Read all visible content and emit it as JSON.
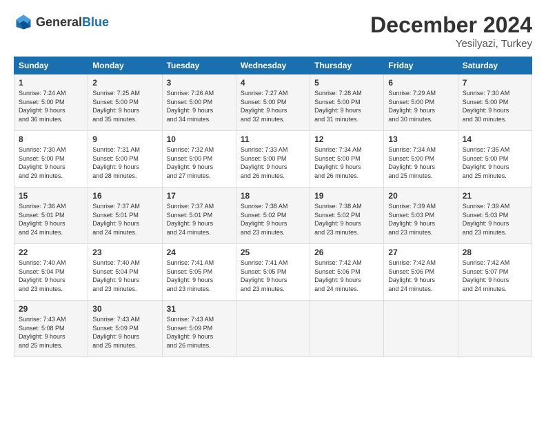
{
  "logo": {
    "text_general": "General",
    "text_blue": "Blue"
  },
  "title": "December 2024",
  "location": "Yesilyazi, Turkey",
  "weekdays": [
    "Sunday",
    "Monday",
    "Tuesday",
    "Wednesday",
    "Thursday",
    "Friday",
    "Saturday"
  ],
  "rows": [
    [
      {
        "day": "1",
        "lines": [
          "Sunrise: 7:24 AM",
          "Sunset: 5:00 PM",
          "Daylight: 9 hours",
          "and 36 minutes."
        ]
      },
      {
        "day": "2",
        "lines": [
          "Sunrise: 7:25 AM",
          "Sunset: 5:00 PM",
          "Daylight: 9 hours",
          "and 35 minutes."
        ]
      },
      {
        "day": "3",
        "lines": [
          "Sunrise: 7:26 AM",
          "Sunset: 5:00 PM",
          "Daylight: 9 hours",
          "and 34 minutes."
        ]
      },
      {
        "day": "4",
        "lines": [
          "Sunrise: 7:27 AM",
          "Sunset: 5:00 PM",
          "Daylight: 9 hours",
          "and 32 minutes."
        ]
      },
      {
        "day": "5",
        "lines": [
          "Sunrise: 7:28 AM",
          "Sunset: 5:00 PM",
          "Daylight: 9 hours",
          "and 31 minutes."
        ]
      },
      {
        "day": "6",
        "lines": [
          "Sunrise: 7:29 AM",
          "Sunset: 5:00 PM",
          "Daylight: 9 hours",
          "and 30 minutes."
        ]
      },
      {
        "day": "7",
        "lines": [
          "Sunrise: 7:30 AM",
          "Sunset: 5:00 PM",
          "Daylight: 9 hours",
          "and 30 minutes."
        ]
      }
    ],
    [
      {
        "day": "8",
        "lines": [
          "Sunrise: 7:30 AM",
          "Sunset: 5:00 PM",
          "Daylight: 9 hours",
          "and 29 minutes."
        ]
      },
      {
        "day": "9",
        "lines": [
          "Sunrise: 7:31 AM",
          "Sunset: 5:00 PM",
          "Daylight: 9 hours",
          "and 28 minutes."
        ]
      },
      {
        "day": "10",
        "lines": [
          "Sunrise: 7:32 AM",
          "Sunset: 5:00 PM",
          "Daylight: 9 hours",
          "and 27 minutes."
        ]
      },
      {
        "day": "11",
        "lines": [
          "Sunrise: 7:33 AM",
          "Sunset: 5:00 PM",
          "Daylight: 9 hours",
          "and 26 minutes."
        ]
      },
      {
        "day": "12",
        "lines": [
          "Sunrise: 7:34 AM",
          "Sunset: 5:00 PM",
          "Daylight: 9 hours",
          "and 26 minutes."
        ]
      },
      {
        "day": "13",
        "lines": [
          "Sunrise: 7:34 AM",
          "Sunset: 5:00 PM",
          "Daylight: 9 hours",
          "and 25 minutes."
        ]
      },
      {
        "day": "14",
        "lines": [
          "Sunrise: 7:35 AM",
          "Sunset: 5:00 PM",
          "Daylight: 9 hours",
          "and 25 minutes."
        ]
      }
    ],
    [
      {
        "day": "15",
        "lines": [
          "Sunrise: 7:36 AM",
          "Sunset: 5:01 PM",
          "Daylight: 9 hours",
          "and 24 minutes."
        ]
      },
      {
        "day": "16",
        "lines": [
          "Sunrise: 7:37 AM",
          "Sunset: 5:01 PM",
          "Daylight: 9 hours",
          "and 24 minutes."
        ]
      },
      {
        "day": "17",
        "lines": [
          "Sunrise: 7:37 AM",
          "Sunset: 5:01 PM",
          "Daylight: 9 hours",
          "and 24 minutes."
        ]
      },
      {
        "day": "18",
        "lines": [
          "Sunrise: 7:38 AM",
          "Sunset: 5:02 PM",
          "Daylight: 9 hours",
          "and 23 minutes."
        ]
      },
      {
        "day": "19",
        "lines": [
          "Sunrise: 7:38 AM",
          "Sunset: 5:02 PM",
          "Daylight: 9 hours",
          "and 23 minutes."
        ]
      },
      {
        "day": "20",
        "lines": [
          "Sunrise: 7:39 AM",
          "Sunset: 5:03 PM",
          "Daylight: 9 hours",
          "and 23 minutes."
        ]
      },
      {
        "day": "21",
        "lines": [
          "Sunrise: 7:39 AM",
          "Sunset: 5:03 PM",
          "Daylight: 9 hours",
          "and 23 minutes."
        ]
      }
    ],
    [
      {
        "day": "22",
        "lines": [
          "Sunrise: 7:40 AM",
          "Sunset: 5:04 PM",
          "Daylight: 9 hours",
          "and 23 minutes."
        ]
      },
      {
        "day": "23",
        "lines": [
          "Sunrise: 7:40 AM",
          "Sunset: 5:04 PM",
          "Daylight: 9 hours",
          "and 23 minutes."
        ]
      },
      {
        "day": "24",
        "lines": [
          "Sunrise: 7:41 AM",
          "Sunset: 5:05 PM",
          "Daylight: 9 hours",
          "and 23 minutes."
        ]
      },
      {
        "day": "25",
        "lines": [
          "Sunrise: 7:41 AM",
          "Sunset: 5:05 PM",
          "Daylight: 9 hours",
          "and 23 minutes."
        ]
      },
      {
        "day": "26",
        "lines": [
          "Sunrise: 7:42 AM",
          "Sunset: 5:06 PM",
          "Daylight: 9 hours",
          "and 24 minutes."
        ]
      },
      {
        "day": "27",
        "lines": [
          "Sunrise: 7:42 AM",
          "Sunset: 5:06 PM",
          "Daylight: 9 hours",
          "and 24 minutes."
        ]
      },
      {
        "day": "28",
        "lines": [
          "Sunrise: 7:42 AM",
          "Sunset: 5:07 PM",
          "Daylight: 9 hours",
          "and 24 minutes."
        ]
      }
    ],
    [
      {
        "day": "29",
        "lines": [
          "Sunrise: 7:43 AM",
          "Sunset: 5:08 PM",
          "Daylight: 9 hours",
          "and 25 minutes."
        ]
      },
      {
        "day": "30",
        "lines": [
          "Sunrise: 7:43 AM",
          "Sunset: 5:09 PM",
          "Daylight: 9 hours",
          "and 25 minutes."
        ]
      },
      {
        "day": "31",
        "lines": [
          "Sunrise: 7:43 AM",
          "Sunset: 5:09 PM",
          "Daylight: 9 hours",
          "and 26 minutes."
        ]
      },
      null,
      null,
      null,
      null
    ]
  ]
}
